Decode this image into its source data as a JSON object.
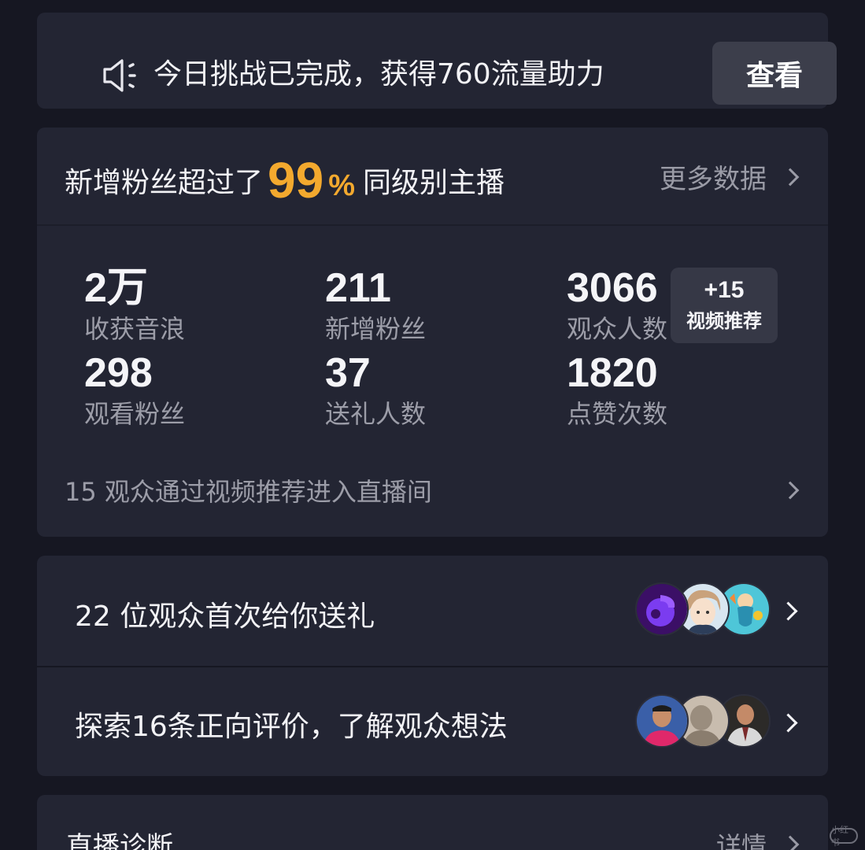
{
  "banner": {
    "icon": "speaker-icon",
    "text": "今日挑战已完成，获得760流量助力",
    "button_label": "查看"
  },
  "stats_card": {
    "headline_prefix": "新增粉丝超过了",
    "headline_percent": "99",
    "headline_percent_sign": "%",
    "headline_suffix": "同级别主播",
    "more_data_label": "更多数据",
    "stats": [
      {
        "value": "2万",
        "label": "收获音浪"
      },
      {
        "value": "211",
        "label": "新增粉丝"
      },
      {
        "value": "3066",
        "label": "观众人数"
      },
      {
        "value": "298",
        "label": "观看粉丝"
      },
      {
        "value": "37",
        "label": "送礼人数"
      },
      {
        "value": "1820",
        "label": "点赞次数"
      }
    ],
    "badge": {
      "value": "+15",
      "label": "视频推荐"
    },
    "footer_text": "15 观众通过视频推荐进入直播间"
  },
  "gift_row": {
    "text": "22 位观众首次给你送礼",
    "avatars": [
      "avatar-purple-logo",
      "avatar-anime-boy",
      "avatar-cartoon-mermaid"
    ]
  },
  "review_row": {
    "text": "探索16条正向评价，了解观众想法",
    "avatars": [
      "avatar-man-red-shirt",
      "avatar-blurred-person",
      "avatar-man-suit"
    ]
  },
  "diagnosis": {
    "title": "直播诊断",
    "detail_label": "详情"
  },
  "watermark": "小红书",
  "colors": {
    "background": "#161722",
    "card": "#232533",
    "accent_percent": "#f3a92e",
    "muted_text": "#9c9da8"
  }
}
